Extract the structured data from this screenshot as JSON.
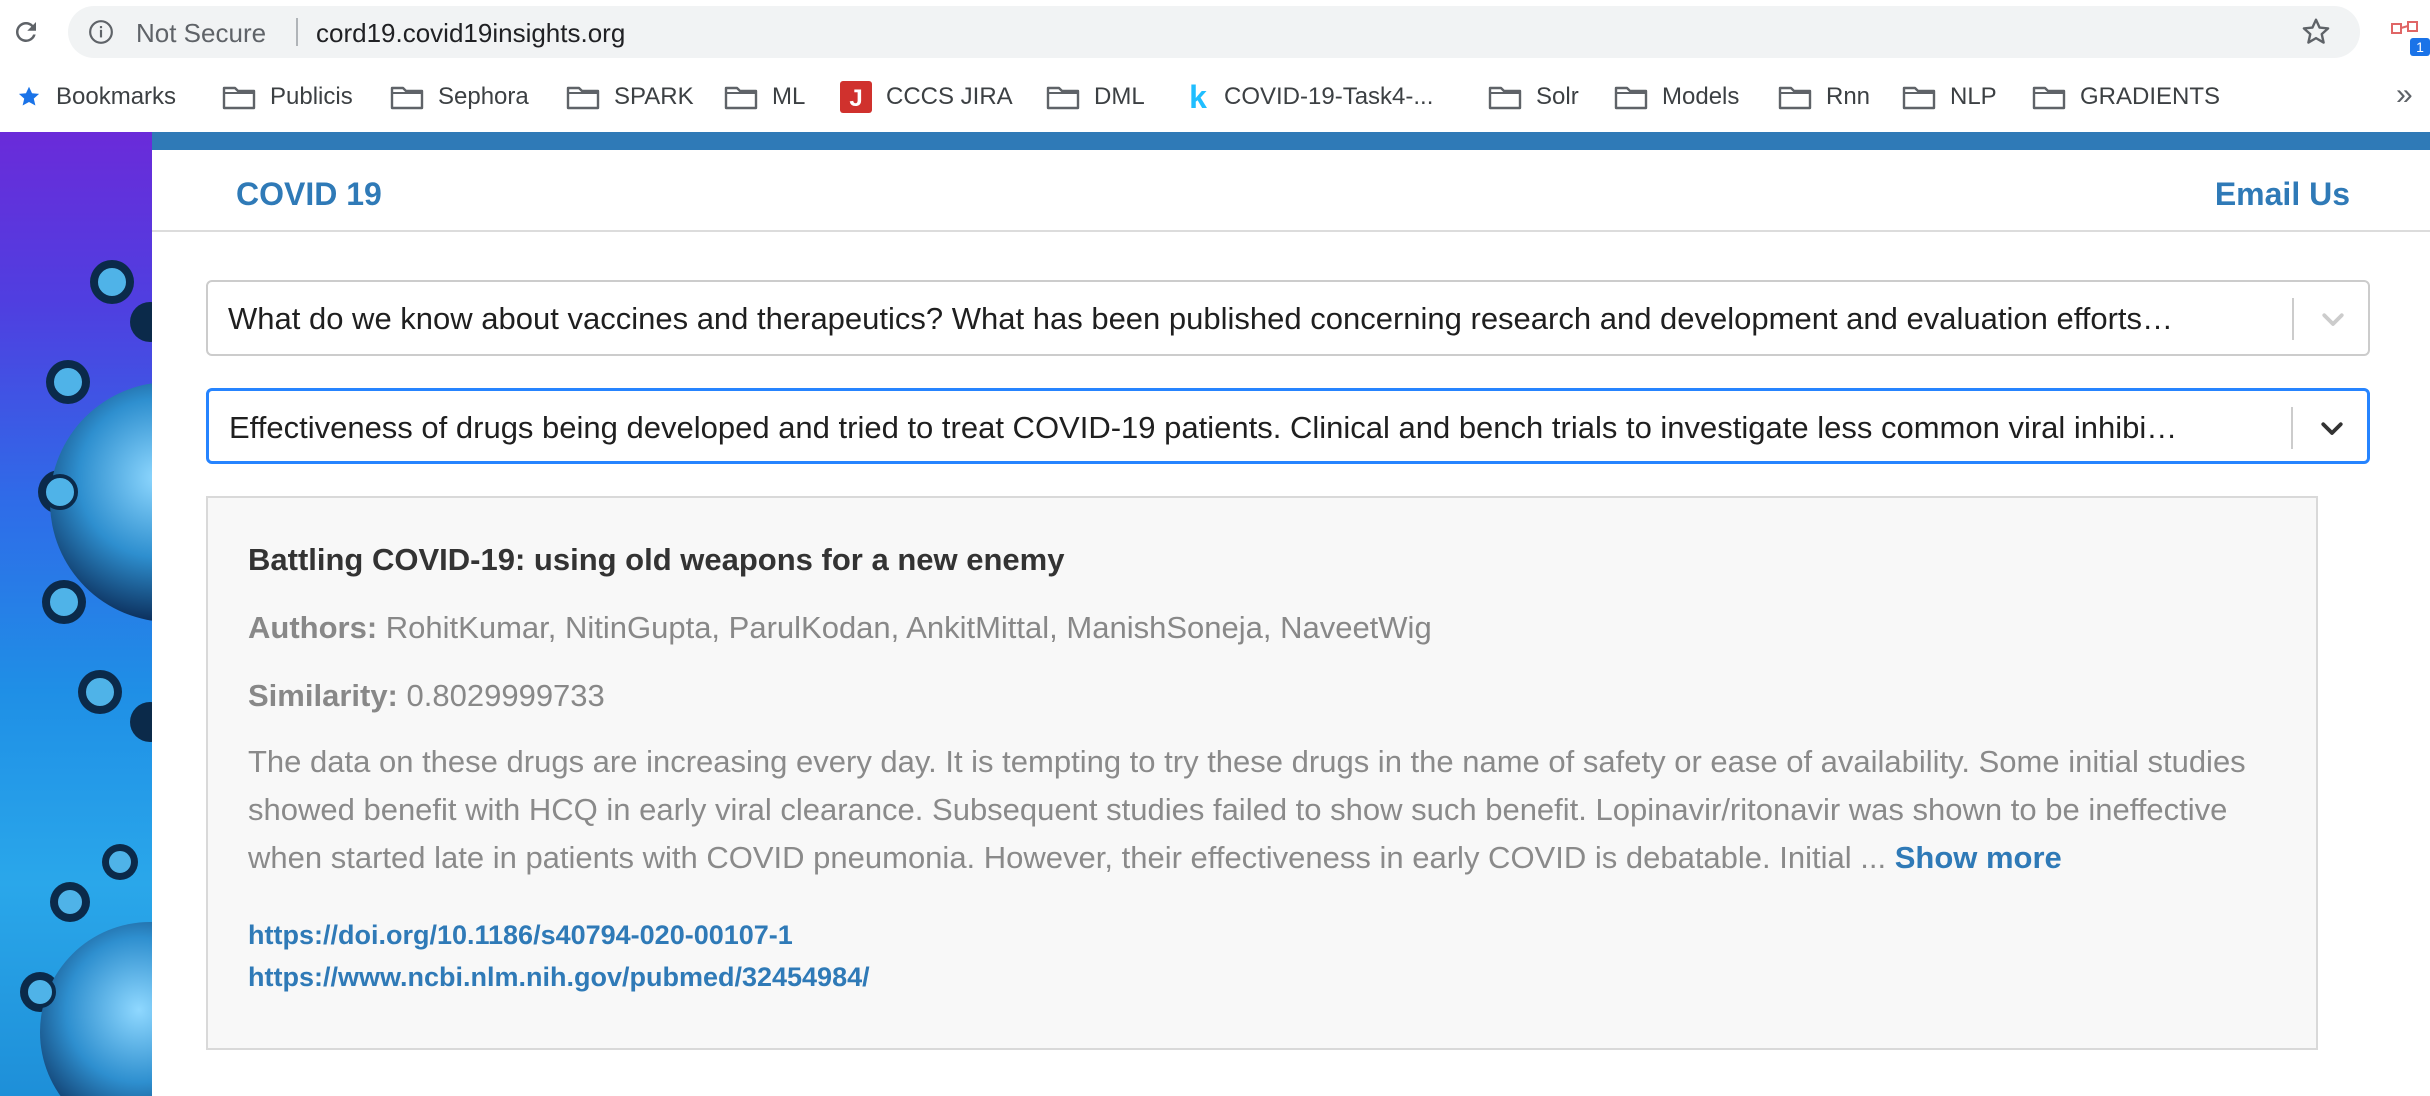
{
  "browser": {
    "security_label": "Not Secure",
    "url": "cord19.covid19insights.org",
    "extension_badge": "1",
    "bookmarks": [
      {
        "label": "Bookmarks",
        "icon": "star-icon"
      },
      {
        "label": "Publicis",
        "icon": "folder-icon"
      },
      {
        "label": "Sephora",
        "icon": "folder-icon"
      },
      {
        "label": "SPARK",
        "icon": "folder-icon"
      },
      {
        "label": "ML",
        "icon": "folder-icon"
      },
      {
        "label": "CCCS JIRA",
        "icon": "jira-icon",
        "icon_letter": "J"
      },
      {
        "label": "DML",
        "icon": "folder-icon"
      },
      {
        "label": "COVID-19-Task4-...",
        "icon": "kaggle-icon",
        "icon_letter": "k"
      },
      {
        "label": "Solr",
        "icon": "folder-icon"
      },
      {
        "label": "Models",
        "icon": "folder-icon"
      },
      {
        "label": "Rnn",
        "icon": "folder-icon"
      },
      {
        "label": "NLP",
        "icon": "folder-icon"
      },
      {
        "label": "GRADIENTS",
        "icon": "folder-icon"
      }
    ],
    "more_label": "»"
  },
  "nav": {
    "brand": "COVID 19",
    "email": "Email Us"
  },
  "selects": {
    "task": "What do we know about vaccines and therapeutics? What has been published concerning research and development and evaluation efforts…",
    "subtask": "Effectiveness of drugs being developed and tried to treat COVID-19 patients. Clinical and bench trials to investigate less common viral inhibi…"
  },
  "result": {
    "title": "Battling COVID-19: using old weapons for a new enemy",
    "authors_label": "Authors:",
    "authors": "RohitKumar, NitinGupta, ParulKodan, AnkitMittal, ManishSoneja, NaveetWig",
    "similarity_label": "Similarity:",
    "similarity": "0.8029999733",
    "abstract": "The data on these drugs are increasing every day. It is tempting to try these drugs in the name of safety or ease of availability. Some initial studies showed benefit with HCQ in early viral clearance. Subsequent studies failed to show such benefit. Lopinavir/ritonavir was shown to be ineffective when started late in patients with COVID pneumonia. However, their effectiveness in early COVID is debatable. Initial ...",
    "show_more": "Show more",
    "links": [
      "https://doi.org/10.1186/s40794-020-00107-1",
      "https://www.ncbi.nlm.nih.gov/pubmed/32454984/"
    ]
  },
  "colors": {
    "accent": "#2f7ab7",
    "focus_border": "#2684ff",
    "jira_red": "#d0312d",
    "kaggle_blue": "#20beff"
  }
}
